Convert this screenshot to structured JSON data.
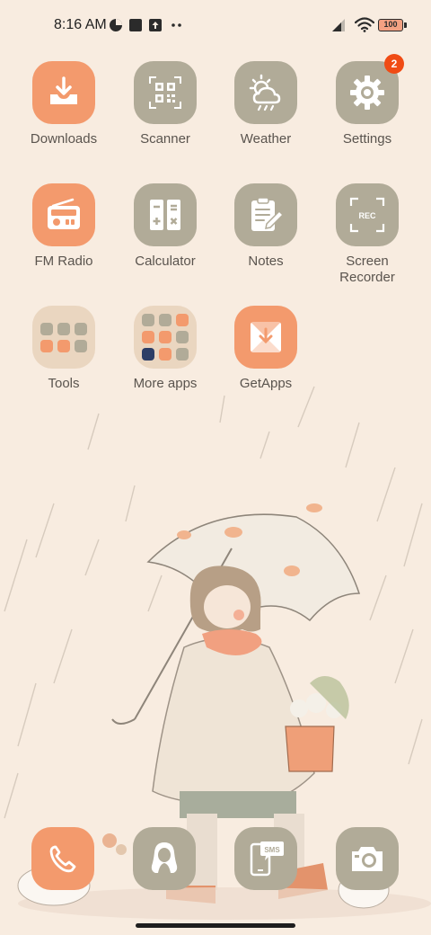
{
  "status": {
    "time": "8:16 AM",
    "battery": "100"
  },
  "apps": {
    "downloads": "Downloads",
    "scanner": "Scanner",
    "weather": "Weather",
    "settings": "Settings",
    "settings_badge": "2",
    "fm_radio": "FM Radio",
    "calculator": "Calculator",
    "notes": "Notes",
    "screen_recorder": "Screen Recorder",
    "tools": "Tools",
    "more_apps": "More apps",
    "getapps": "GetApps"
  },
  "icon_text": {
    "rec": "REC",
    "sms": "SMS"
  },
  "colors": {
    "accent_orange": "#f39a6d",
    "icon_grey": "#b1ab98",
    "background": "#f8ece0",
    "badge_red": "#f04b14"
  }
}
